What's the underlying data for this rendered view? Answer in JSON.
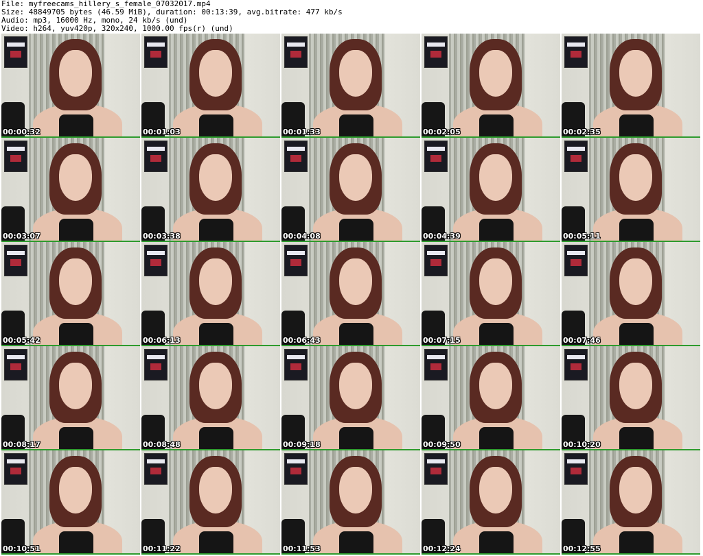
{
  "header": {
    "file": "File: myfreecams_hillery_s_female_07032017.mp4",
    "size": "Size: 48849705 bytes (46.59 MiB), duration: 00:13:39, avg.bitrate: 477 kb/s",
    "audio": "Audio: mp3, 16000 Hz, mono, 24 kb/s (und)",
    "video": "Video: h264, yuv420p, 320x240, 1000.00 fps(r) (und)"
  },
  "thumbnails": [
    "00:00:32",
    "00:01:03",
    "00:01:33",
    "00:02:05",
    "00:02:35",
    "00:03:07",
    "00:03:38",
    "00:04:08",
    "00:04:39",
    "00:05:11",
    "00:05:42",
    "00:06:13",
    "00:06:43",
    "00:07:15",
    "00:07:46",
    "00:08:17",
    "00:08:48",
    "00:09:18",
    "00:09:50",
    "00:10:20",
    "00:10:51",
    "00:11:22",
    "00:11:53",
    "00:12:24",
    "00:12:55"
  ],
  "colors": {
    "separator": "#2e9b2e",
    "timestamp": "#ffffff"
  }
}
